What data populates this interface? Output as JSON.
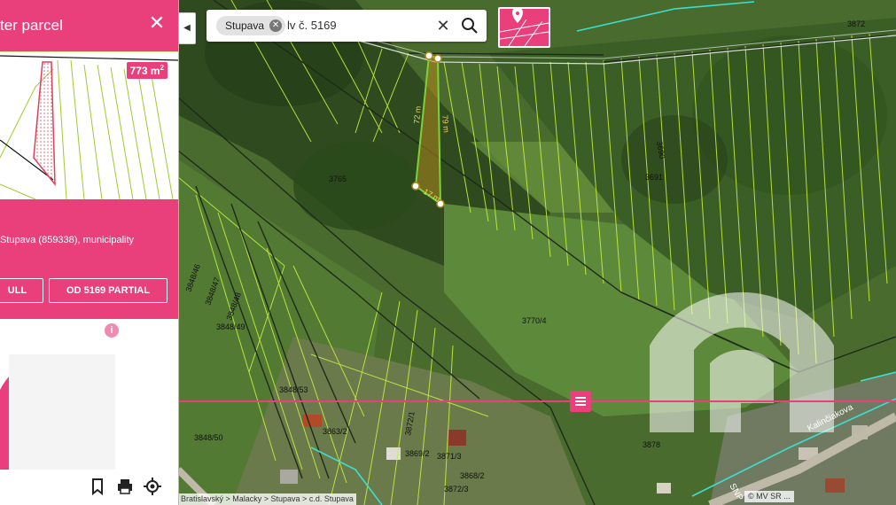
{
  "panel": {
    "title": "ter parcel",
    "area_value": "773 m",
    "area_unit_sup": "2",
    "location": "Stupava (859338), municipality",
    "buttons": {
      "full": "ULL",
      "partial": "OD 5169 PARTIAL"
    },
    "info_icon": "i"
  },
  "search": {
    "chip": "Stupava",
    "query": "lv č. 5169",
    "clear_icon": "close-icon",
    "search_icon": "search-icon"
  },
  "map": {
    "parcel_labels": [
      "3770/4",
      "3848/46",
      "3848/47",
      "3848/48",
      "3848/49",
      "3848/50",
      "3848/53",
      "3863/2",
      "3869/2",
      "3871/3",
      "3872/1",
      "3872/3",
      "3868/2",
      "3878",
      "3691",
      "3690",
      "3872",
      "3765"
    ],
    "street_label": "Kalinčiakova",
    "street_label_2": "SNP",
    "measure_labels": [
      "72 m",
      "79 m",
      "17 m"
    ],
    "breadcrumb": "Bratislavský > Malacky > Stupava > c.d. Stupava",
    "copyright": "© MV SR ..."
  },
  "colors": {
    "accent": "#e93f7a",
    "parcel_line": "#c6ee3f",
    "boundary": "#1f2a1a",
    "selected": "#7bd13a"
  },
  "footer_icons": [
    "bookmark-icon",
    "print-icon",
    "locate-icon"
  ]
}
